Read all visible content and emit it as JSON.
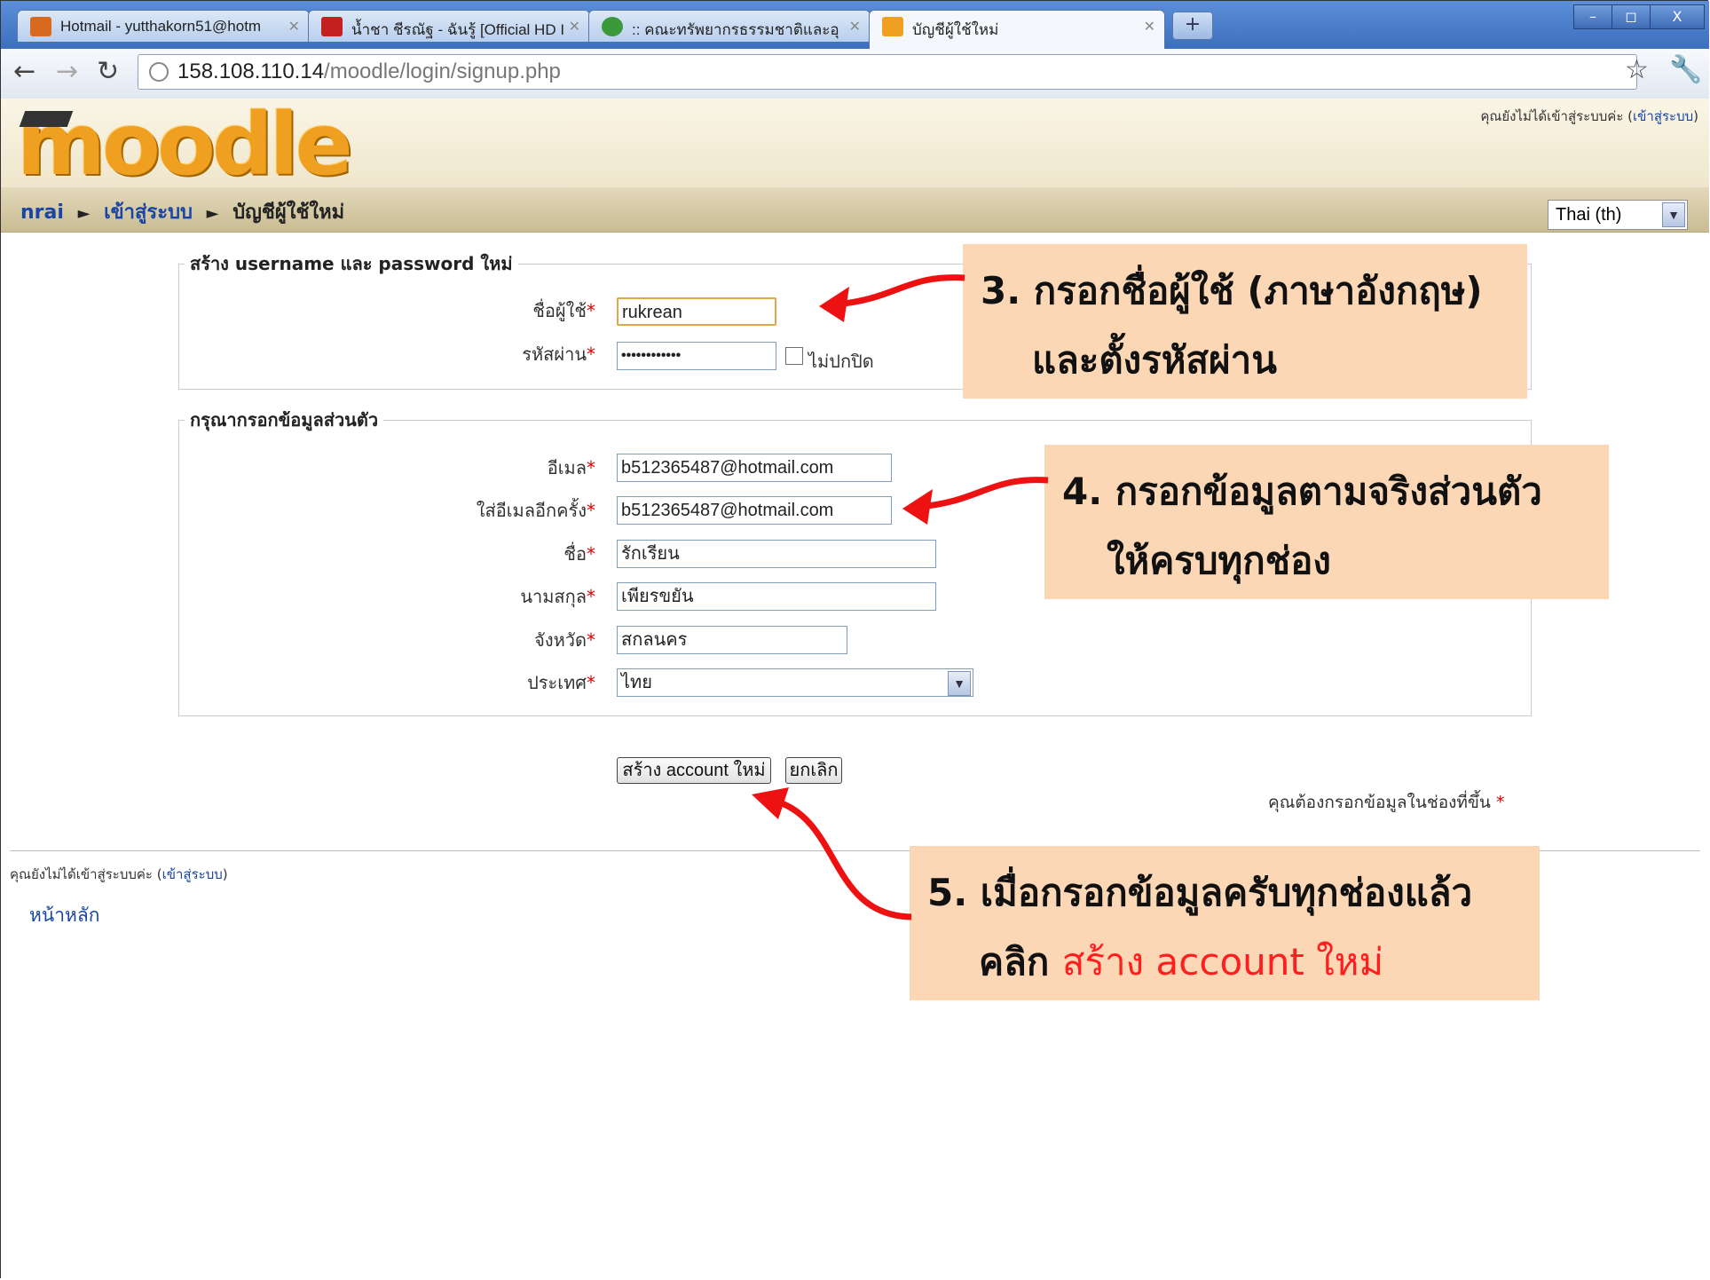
{
  "browser": {
    "tabs": [
      {
        "title": "Hotmail - yutthakorn51@hotm",
        "icon_color": "#d86a1f"
      },
      {
        "title": "น้ำชา ชีรณัฐ - ฉันรู้ [Official HD I",
        "icon_color": "#c42020"
      },
      {
        "title": ":: คณะทรัพยากรธรรมชาติและอุ",
        "icon_color": "#3a9a3a"
      },
      {
        "title": "บัญชีผู้ใช้ใหม่",
        "icon_color": "#f0a020"
      }
    ],
    "new_tab": "+",
    "window_buttons": [
      "–",
      "◻",
      "X"
    ],
    "url_host": "158.108.110.14",
    "url_path": "/moodle/login/signup.php"
  },
  "header": {
    "logo": "moodle",
    "login_state": "คุณยังไม่ได้เข้าสู่ระบบค่ะ",
    "login_link": "เข้าสู่ระบบ"
  },
  "breadcrumb": {
    "home": "nrai",
    "login": "เข้าสู่ระบบ",
    "current": "บัญชีผู้ใช้ใหม่"
  },
  "language": "Thai (th)",
  "fieldset_account": {
    "legend": "สร้าง username และ password ใหม่",
    "username_label": "ชื่อผู้ใช้",
    "username_value": "rukrean",
    "password_label": "รหัสผ่าน",
    "password_value": "••••••••••••",
    "unmask_label": "ไม่ปกปิด"
  },
  "fieldset_personal": {
    "legend": "กรุณากรอกข้อมูลส่วนตัว",
    "email_label": "อีเมล",
    "email_value": "b512365487@hotmail.com",
    "email2_label": "ใส่อีเมลอีกครั้ง",
    "email2_value": "b512365487@hotmail.com",
    "firstname_label": "ชื่อ",
    "firstname_value": "รักเรียน",
    "lastname_label": "นามสกุล",
    "lastname_value": "เพียรขยัน",
    "city_label": "จังหวัด",
    "city_value": "สกลนคร",
    "country_label": "ประเทศ",
    "country_value": "ไทย"
  },
  "buttons": {
    "submit": "สร้าง account ใหม่",
    "cancel": "ยกเลิก"
  },
  "required_note": "คุณต้องกรอกข้อมูลในช่องที่ขึ้น",
  "required_marker": "*",
  "footer": {
    "login_state": "คุณยังไม่ได้เข้าสู่ระบบค่ะ",
    "login_link": "เข้าสู่ระบบ",
    "home_link": "หน้าหลัก"
  },
  "annotations": {
    "step3_line1": "3. กรอกชื่อผู้ใช้ (ภาษาอังกฤษ)",
    "step3_line2": "และตั้งรหัสผ่าน",
    "step4_line1": "4. กรอกข้อมูลตามจริงส่วนตัว",
    "step4_line2": "ให้ครบทุกช่อง",
    "step5_line1": "5. เมื่อกรอกข้อมูลครับทุกช่องแล้ว",
    "step5_click": "คลิก",
    "step5_target": "สร้าง account ใหม่"
  },
  "colors": {
    "callout_bg": "#fbd7b5",
    "arrow_red": "#ee1111",
    "link_blue": "#1845a6",
    "required_red": "#dd0000"
  }
}
